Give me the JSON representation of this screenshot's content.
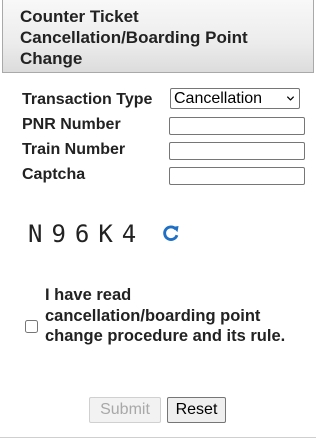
{
  "header": {
    "title": "Counter Ticket Cancellation/Boarding Point Change"
  },
  "form": {
    "transaction_type": {
      "label": "Transaction Type",
      "selected": "Cancellation"
    },
    "pnr_number": {
      "label": "PNR Number",
      "value": ""
    },
    "train_number": {
      "label": "Train Number",
      "value": ""
    },
    "captcha": {
      "label": "Captcha",
      "value": "",
      "code": "N96K4",
      "refresh_icon": "refresh-icon"
    }
  },
  "agreement": {
    "text": "I have read cancellation/boarding point change procedure and its rule.",
    "checked": false
  },
  "actions": {
    "submit_label": "Submit",
    "reset_label": "Reset"
  },
  "colors": {
    "refresh_icon": "#1f6fc5",
    "submit_disabled_text": "#a8a8a8"
  }
}
